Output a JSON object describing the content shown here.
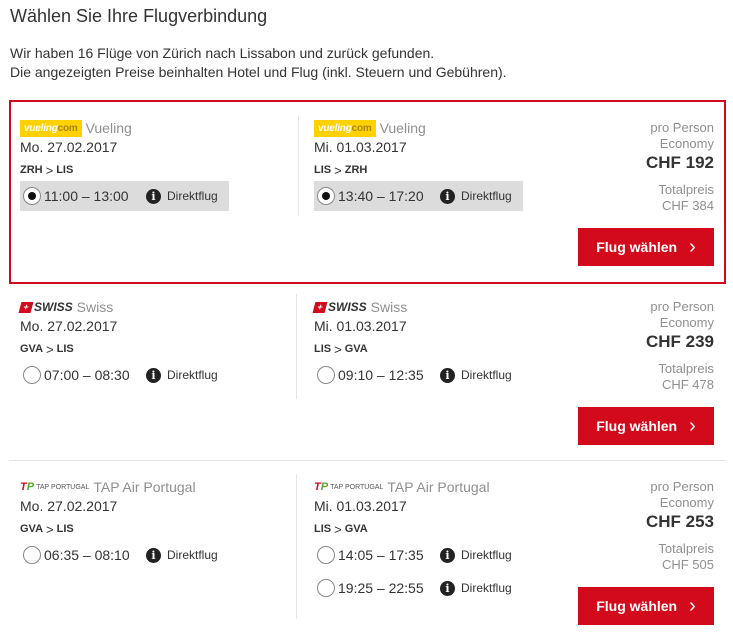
{
  "header": {
    "title": "Wählen Sie Ihre Flugverbindung",
    "intro_line1": "Wir haben 16 Flüge von Zürich nach Lissabon und zurück gefunden.",
    "intro_line2": "Die angezeigten Preise beinhalten Hotel und Flug (inkl. Steuern und Gebühren)."
  },
  "colors": {
    "accent": "#d3091c",
    "selected_option_bg": "#dcdcdc",
    "muted_text": "#8f8f8f"
  },
  "labels": {
    "info_icon": "i",
    "chevron": ">",
    "direct_flight": "Direktflug",
    "per_person": "pro Person",
    "class": "Economy",
    "total_price": "Totalpreis",
    "select_button": "Flug wählen"
  },
  "logos": {
    "vueling_main": "vueling",
    "vueling_com": "com",
    "swiss": "SWISS",
    "swiss_cross": "+",
    "tap_t": "T",
    "tap_p": "P",
    "tap_text": "TAP PORTUGAL"
  },
  "flights": [
    {
      "selected": true,
      "outbound": {
        "airline": "Vueling",
        "date": "Mo. 27.02.2017",
        "from": "ZRH",
        "to": "LIS",
        "options": [
          {
            "time": "11:00 – 13:00",
            "selected": true
          }
        ]
      },
      "inbound": {
        "airline": "Vueling",
        "date": "Mi. 01.03.2017",
        "from": "LIS",
        "to": "ZRH",
        "options": [
          {
            "time": "13:40 – 17:20",
            "selected": true
          }
        ]
      },
      "price_per_person": "CHF 192",
      "total_price": "CHF 384"
    },
    {
      "selected": false,
      "outbound": {
        "airline": "Swiss",
        "date": "Mo. 27.02.2017",
        "from": "GVA",
        "to": "LIS",
        "options": [
          {
            "time": "07:00 – 08:30",
            "selected": false
          }
        ]
      },
      "inbound": {
        "airline": "Swiss",
        "date": "Mi. 01.03.2017",
        "from": "LIS",
        "to": "GVA",
        "options": [
          {
            "time": "09:10 – 12:35",
            "selected": false
          }
        ]
      },
      "price_per_person": "CHF 239",
      "total_price": "CHF 478"
    },
    {
      "selected": false,
      "outbound": {
        "airline": "TAP Air Portugal",
        "date": "Mo. 27.02.2017",
        "from": "GVA",
        "to": "LIS",
        "options": [
          {
            "time": "06:35 – 08:10",
            "selected": false
          }
        ]
      },
      "inbound": {
        "airline": "TAP Air Portugal",
        "date": "Mi. 01.03.2017",
        "from": "LIS",
        "to": "GVA",
        "options": [
          {
            "time": "14:05 – 17:35",
            "selected": false
          },
          {
            "time": "19:25 – 22:55",
            "selected": false
          }
        ]
      },
      "price_per_person": "CHF 253",
      "total_price": "CHF 505"
    }
  ]
}
